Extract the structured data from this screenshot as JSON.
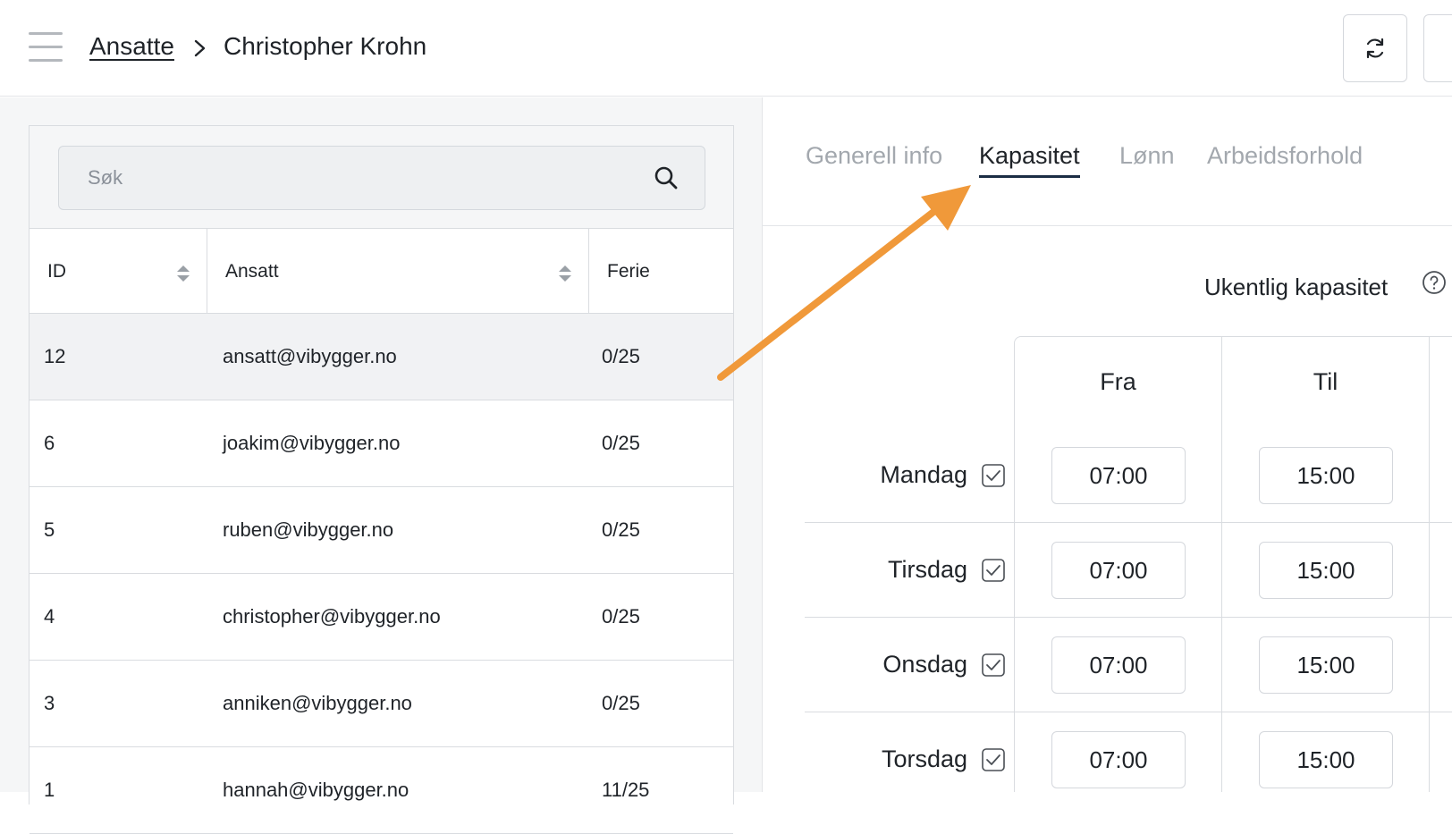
{
  "header": {
    "menu_icon": "hamburger-menu-icon",
    "breadcrumb_parent": "Ansatte",
    "breadcrumb_separator_icon": "chevron-right-icon",
    "breadcrumb_current": "Christopher Krohn",
    "refresh_icon": "refresh-icon"
  },
  "employee_list": {
    "search": {
      "placeholder": "Søk",
      "value": "",
      "icon": "search-icon"
    },
    "columns": {
      "id": "ID",
      "employee": "Ansatt",
      "vacation": "Ferie"
    },
    "rows": [
      {
        "id": "12",
        "email": "ansatt@vibygger.no",
        "vacation": "0/25",
        "selected": true
      },
      {
        "id": "6",
        "email": "joakim@vibygger.no",
        "vacation": "0/25",
        "selected": false
      },
      {
        "id": "5",
        "email": "ruben@vibygger.no",
        "vacation": "0/25",
        "selected": false
      },
      {
        "id": "4",
        "email": "christopher@vibygger.no",
        "vacation": "0/25",
        "selected": false
      },
      {
        "id": "3",
        "email": "anniken@vibygger.no",
        "vacation": "0/25",
        "selected": false
      },
      {
        "id": "1",
        "email": "hannah@vibygger.no",
        "vacation": "11/25",
        "selected": false
      }
    ]
  },
  "tabs": [
    {
      "label": "Generell info",
      "active": false
    },
    {
      "label": "Kapasitet",
      "active": true
    },
    {
      "label": "Lønn",
      "active": false
    },
    {
      "label": "Arbeidsforhold",
      "active": false
    }
  ],
  "capacity": {
    "title": "Ukentlig kapasitet",
    "help_icon": "question-circle-icon",
    "col_from": "Fra",
    "col_to": "Til",
    "days": [
      {
        "name": "Mandag",
        "checked": true,
        "from": "07:00",
        "to": "15:00"
      },
      {
        "name": "Tirsdag",
        "checked": true,
        "from": "07:00",
        "to": "15:00"
      },
      {
        "name": "Onsdag",
        "checked": true,
        "from": "07:00",
        "to": "15:00"
      },
      {
        "name": "Torsdag",
        "checked": true,
        "from": "07:00",
        "to": "15:00"
      }
    ]
  },
  "colors": {
    "accent_tab_underline": "#1b2d44",
    "annotation_arrow": "#f0993a",
    "panel_background": "#f5f6f7",
    "selected_row": "#f1f2f4"
  }
}
